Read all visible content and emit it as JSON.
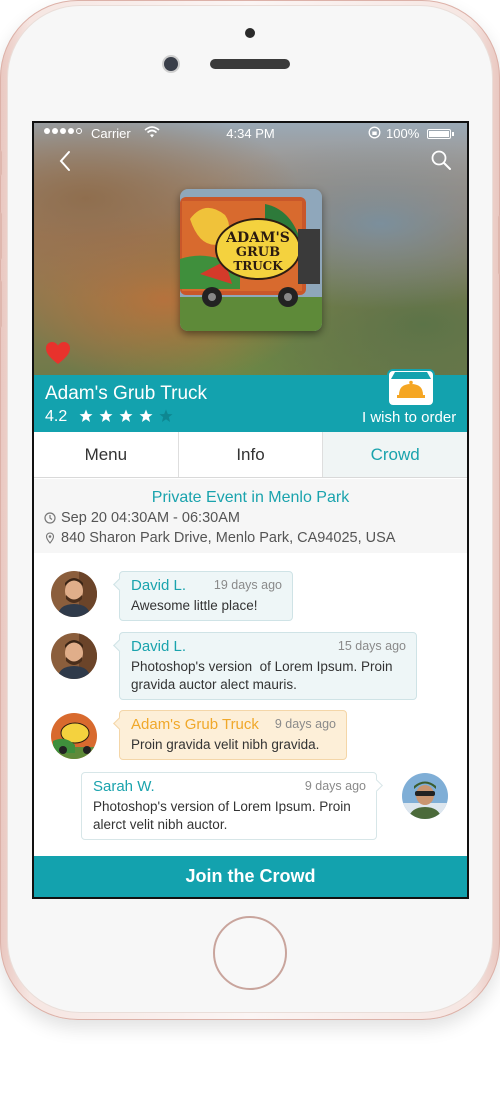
{
  "status_bar": {
    "carrier": "Carrier",
    "time": "4:34 PM",
    "battery": "100%"
  },
  "truck": {
    "name": "Adam's Grub Truck",
    "rating": "4.2",
    "stars_filled": 4,
    "stars_total": 5,
    "order_label": "I wish to order",
    "photo_sign": "ADAM'S GRUB TRUCK"
  },
  "tabs": [
    {
      "label": "Menu"
    },
    {
      "label": "Info"
    },
    {
      "label": "Crowd"
    }
  ],
  "event": {
    "title": "Private Event in Menlo Park",
    "time": "Sep 20 04:30AM - 06:30AM",
    "address": "840 Sharon Park Drive, Menlo Park, CA94025, USA"
  },
  "messages": [
    {
      "name": "David L.",
      "time": "19 days ago",
      "text": "Awesome little place!"
    },
    {
      "name": "David L.",
      "time": "15 days ago",
      "text_line1": "Photoshop's version  of Lorem Ipsum. Proin",
      "text_line2": "gravida auctor alect mauris."
    },
    {
      "name": "Adam's Grub Truck",
      "time": "9 days ago",
      "text": "Proin gravida velit nibh gravida."
    },
    {
      "name": "Sarah W.",
      "time": "9 days ago",
      "text_line1": "Photoshop's version of Lorem Ipsum. Proin",
      "text_line2": "alerct velit nibh auctor."
    }
  ],
  "cta": {
    "label": "Join the Crowd"
  },
  "colors": {
    "accent": "#13a2ae",
    "accent_text": "#1aa3ad",
    "truck_bubble": "#fdefd8",
    "truck_name": "#f0a82a",
    "heart": "#e8322c"
  },
  "icons": [
    "back-icon",
    "search-icon",
    "heart-icon",
    "star-icon",
    "order-bell-icon",
    "clock-icon",
    "location-pin-icon",
    "wifi-icon"
  ]
}
